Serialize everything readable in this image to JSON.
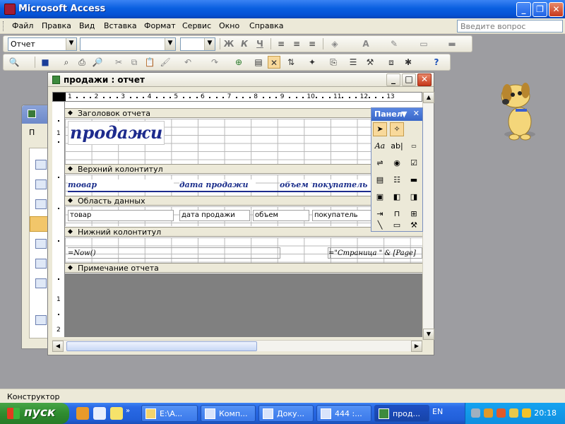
{
  "app": {
    "title": "Microsoft Access"
  },
  "menu": {
    "items": [
      "Файл",
      "Правка",
      "Вид",
      "Вставка",
      "Формат",
      "Сервис",
      "Окно",
      "Справка"
    ],
    "ask_placeholder": "Введите вопрос"
  },
  "format_toolbar": {
    "object_combo": "Отчет",
    "font_combo": "",
    "size_combo": "",
    "bold": "Ж",
    "italic": "К",
    "underline": "Ч"
  },
  "db_window": {
    "label": "П"
  },
  "report_window": {
    "title": "продажи : отчет",
    "ruler_numbers": [
      "1",
      "2",
      "3",
      "4",
      "5",
      "6",
      "7",
      "8",
      "9",
      "10",
      "11",
      "12",
      "13"
    ],
    "vruler_numbers": [
      "1",
      "1",
      "2"
    ],
    "sections": {
      "report_header": "Заголовок отчета",
      "page_header": "Верхний колонтитул",
      "detail": "Область данных",
      "page_footer": "Нижний колонтитул",
      "report_footer": "Примечание отчета"
    },
    "report_title": "продажи",
    "column_labels": [
      "товар",
      "дата продажи",
      "объем",
      "покупатель"
    ],
    "fields": [
      "товар",
      "дата продажи",
      "объем",
      "покупатель"
    ],
    "footer_left": "=Now()",
    "footer_right": "=\"Страница \" & [Page]"
  },
  "toolbox": {
    "title": "Панел"
  },
  "status": {
    "text": "Конструктор"
  },
  "taskbar": {
    "start": "пуск",
    "tasks": [
      "E:\\A...",
      "Комп...",
      "Доку...",
      "444 :...",
      "прод..."
    ],
    "language": "EN",
    "clock": "20:18"
  }
}
